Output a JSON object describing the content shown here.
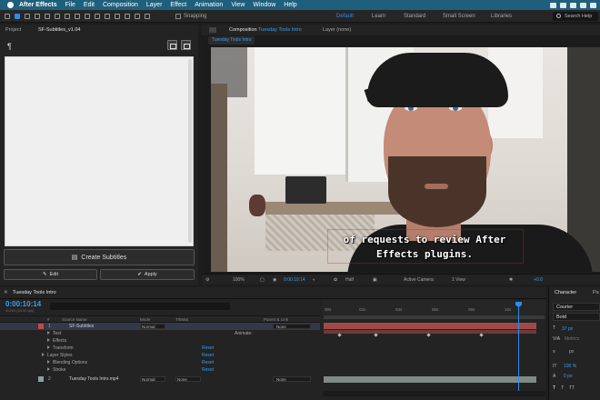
{
  "menubar": {
    "app_name": "After Effects",
    "items": [
      "File",
      "Edit",
      "Composition",
      "Layer",
      "Effect",
      "Animation",
      "View",
      "Window",
      "Help"
    ]
  },
  "toolbar": {
    "snapping_label": "Snapping",
    "workspaces": [
      "Default",
      "Learn",
      "Standard",
      "Small Screen",
      "Libraries"
    ],
    "active_workspace": "Default",
    "search_help_placeholder": "Search Help"
  },
  "left_panel": {
    "tabs": [
      "Project",
      "SF-Subtitles_v1.04"
    ],
    "create_button": "Create Subtitles",
    "edit_button": "Edit",
    "apply_button": "Apply",
    "paragraph_symbol": "¶"
  },
  "composition": {
    "tab_label": "Composition",
    "comp_name": "Tuesday Tools Intro",
    "layer_tab": "Layer (none)",
    "subtab": "Tuesday Tools Intro",
    "subtitle_lines": [
      "of requests to review After",
      "Effects plugins."
    ],
    "footer": {
      "zoom": "100%",
      "timecode": "0:00:10:14",
      "resolution": "Half",
      "camera": "Active Camera",
      "views": "1 View",
      "exposure": "+0.0"
    }
  },
  "timeline": {
    "tab": "Tuesday Tools Intro",
    "timecode": "0:00:10:14",
    "frame_info": "00254 (24.00 fps)",
    "columns": {
      "num": "#",
      "source": "Source Name",
      "mode": "Mode",
      "trkmat": "TrkMat",
      "parent": "Parent & Link"
    },
    "layers": [
      {
        "num": "1",
        "name": "SF-Subtitles",
        "mode": "Normal",
        "parent": "None"
      },
      {
        "num": "2",
        "name": "Tuesday Tools Intro.mp4",
        "mode": "Normal",
        "trkmat": "None",
        "parent": "None"
      }
    ],
    "properties": [
      "Text",
      "Effects",
      "Transform",
      "Layer Styles",
      "Blending Options",
      "Stroke"
    ],
    "reset_label": "Reset",
    "animate_label": "Animate:",
    "ruler_ticks": [
      "00s",
      "02s",
      "04s",
      "06s",
      "08s",
      "10s"
    ]
  },
  "character_panel": {
    "tabs": [
      "Character",
      "Pa"
    ],
    "font": "Courier",
    "style": "Bold",
    "font_size": "37 px",
    "leading": "Metrics",
    "tracking": "px",
    "vertical_scale": "100 %",
    "baseline_shift": "0 px"
  }
}
